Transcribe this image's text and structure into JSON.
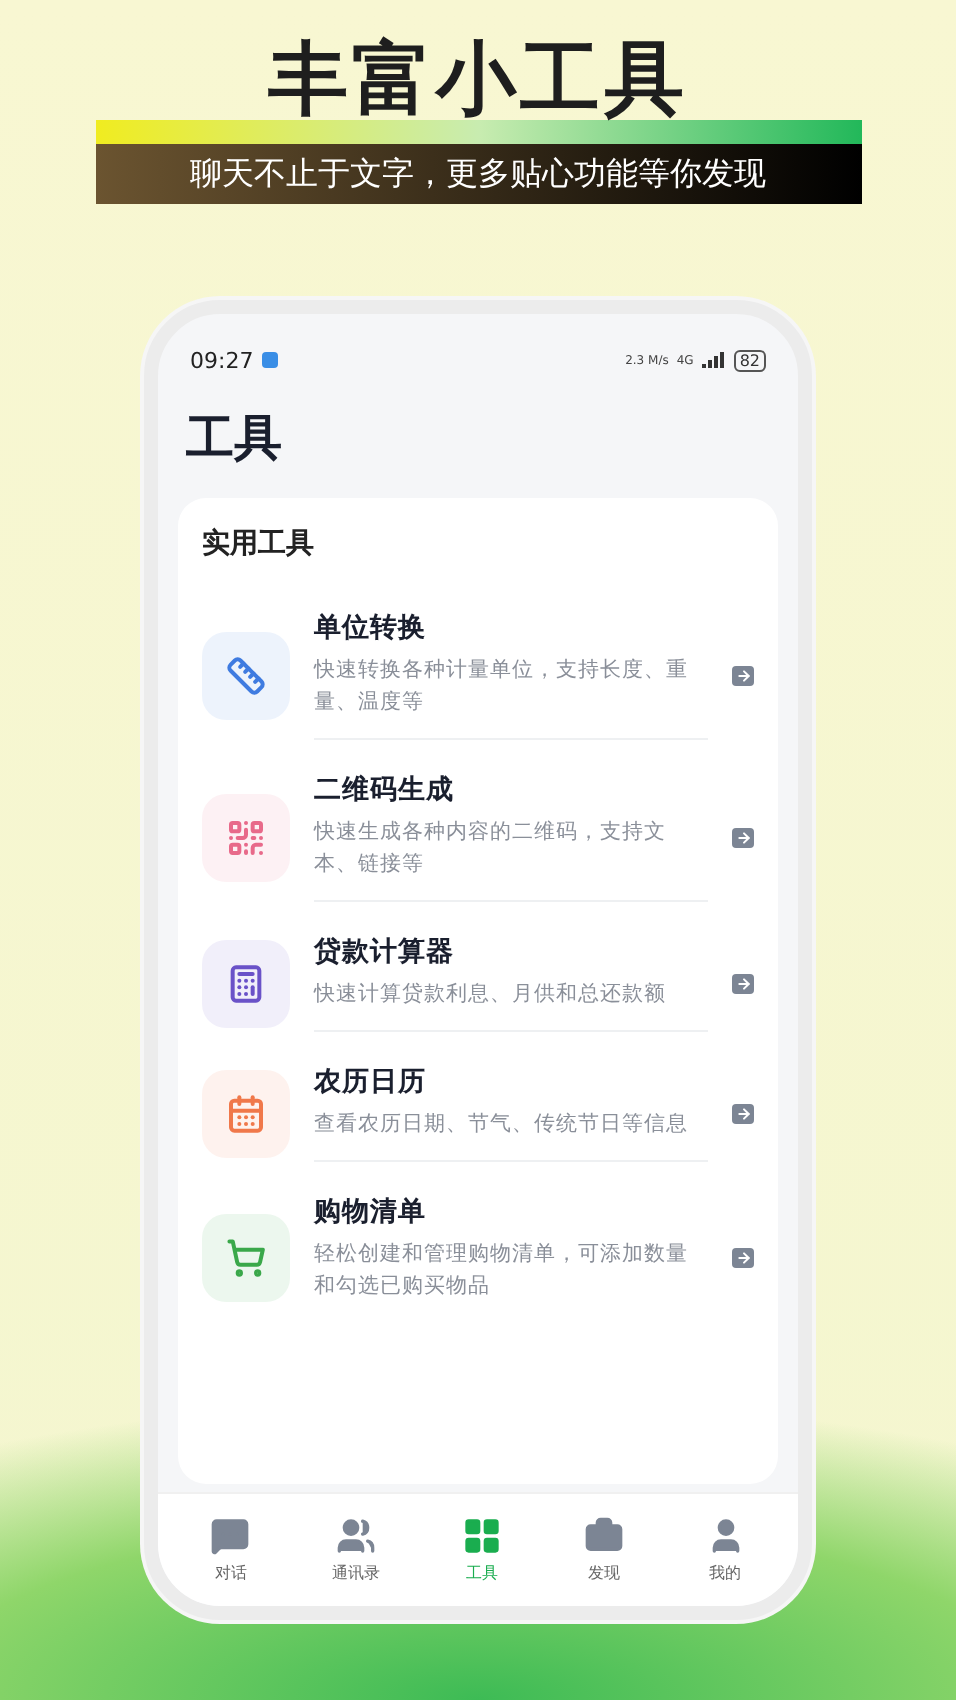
{
  "banner": {
    "title": "丰富小工具",
    "subtitle": "聊天不止于文字，更多贴心功能等你发现"
  },
  "status_bar": {
    "time": "09:27",
    "speed": "2.3 M/s",
    "network": "4G",
    "battery": "82"
  },
  "page_title": "工具",
  "section_title": "实用工具",
  "tools": [
    {
      "kind": "unit",
      "color": "#3f7be0",
      "title": "单位转换",
      "description": "快速转换各种计量单位，支持长度、重量、温度等"
    },
    {
      "kind": "qr",
      "color": "#e86a8a",
      "title": "二维码生成",
      "description": "快速生成各种内容的二维码，支持文本、链接等"
    },
    {
      "kind": "calculator",
      "color": "#6a52c8",
      "title": "贷款计算器",
      "description": "快速计算贷款利息、月供和总还款额"
    },
    {
      "kind": "calendar",
      "color": "#f0784a",
      "title": "农历日历",
      "description": "查看农历日期、节气、传统节日等信息"
    },
    {
      "kind": "cart",
      "color": "#3aa84a",
      "title": "购物清单",
      "description": "轻松创建和管理购物清单，可添加数量和勾选已购买物品"
    }
  ],
  "tabs": [
    {
      "kind": "chat",
      "label": "对话",
      "selected": false
    },
    {
      "kind": "contacts",
      "label": "通讯录",
      "selected": false
    },
    {
      "kind": "tools",
      "label": "工具",
      "selected": true
    },
    {
      "kind": "discover",
      "label": "发现",
      "selected": false
    },
    {
      "kind": "me",
      "label": "我的",
      "selected": false
    }
  ]
}
